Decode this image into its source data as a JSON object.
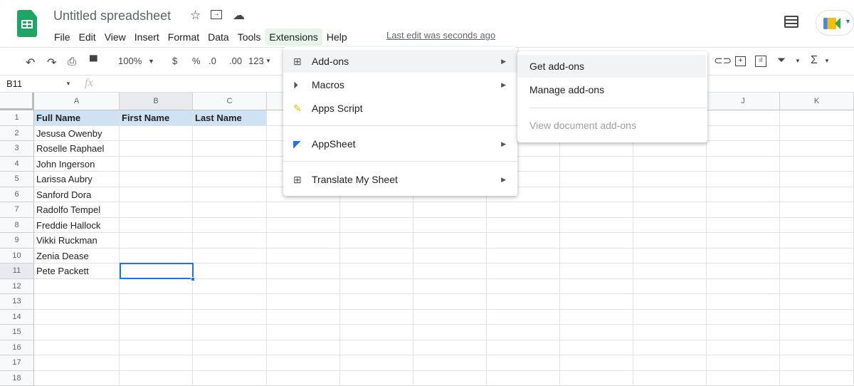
{
  "app": {
    "title": "Untitled spreadsheet",
    "last_edit": "Last edit was seconds ago"
  },
  "menubar": [
    "File",
    "Edit",
    "View",
    "Insert",
    "Format",
    "Data",
    "Tools",
    "Extensions",
    "Help"
  ],
  "toolbar": {
    "zoom": "100%",
    "currency": "$",
    "percent": "%",
    "dec_decrease": ".0",
    "dec_increase": ".00",
    "format": "123"
  },
  "formula_bar": {
    "cell_ref": "B11",
    "fx": "fx",
    "value": ""
  },
  "columns": [
    "A",
    "B",
    "C",
    "D",
    "E",
    "F",
    "G",
    "H",
    "I",
    "J",
    "K"
  ],
  "rows": [
    [
      "Full Name",
      "First Name",
      "Last Name"
    ],
    [
      "Jesusa Owenby",
      "",
      ""
    ],
    [
      "Roselle Raphael",
      "",
      ""
    ],
    [
      "John Ingerson",
      "",
      ""
    ],
    [
      "Larissa Aubry",
      "",
      ""
    ],
    [
      "Sanford Dora",
      "",
      ""
    ],
    [
      "Radolfo Tempel",
      "",
      ""
    ],
    [
      "Freddie Hallock",
      "",
      ""
    ],
    [
      "Vikki Ruckman",
      "",
      ""
    ],
    [
      "Zenia Dease",
      "",
      ""
    ],
    [
      "Pete Packett",
      "",
      ""
    ],
    [
      "",
      "",
      ""
    ],
    [
      "",
      "",
      ""
    ],
    [
      "",
      "",
      ""
    ],
    [
      "",
      "",
      ""
    ],
    [
      "",
      "",
      ""
    ],
    [
      "",
      "",
      ""
    ],
    [
      "",
      "",
      ""
    ]
  ],
  "selected_cell": "B11",
  "extensions_menu": {
    "items": [
      {
        "label": "Add-ons",
        "icon": "addons-icon",
        "submenu": true
      },
      {
        "label": "Macros",
        "icon": "play-circle-icon",
        "submenu": true
      },
      {
        "label": "Apps Script",
        "icon": "apps-script-icon",
        "submenu": false
      },
      {
        "label": "AppSheet",
        "icon": "appsheet-icon",
        "submenu": true
      },
      {
        "label": "Translate My Sheet",
        "icon": "addons-icon",
        "submenu": true
      }
    ]
  },
  "addons_submenu": {
    "items": [
      {
        "label": "Get add-ons",
        "enabled": true
      },
      {
        "label": "Manage add-ons",
        "enabled": true
      },
      {
        "label": "View document add-ons",
        "enabled": false
      }
    ]
  },
  "colors": {
    "accent": "#1a73e8",
    "header_fill": "#cfe2f3",
    "sheets_green": "#1fa463"
  }
}
